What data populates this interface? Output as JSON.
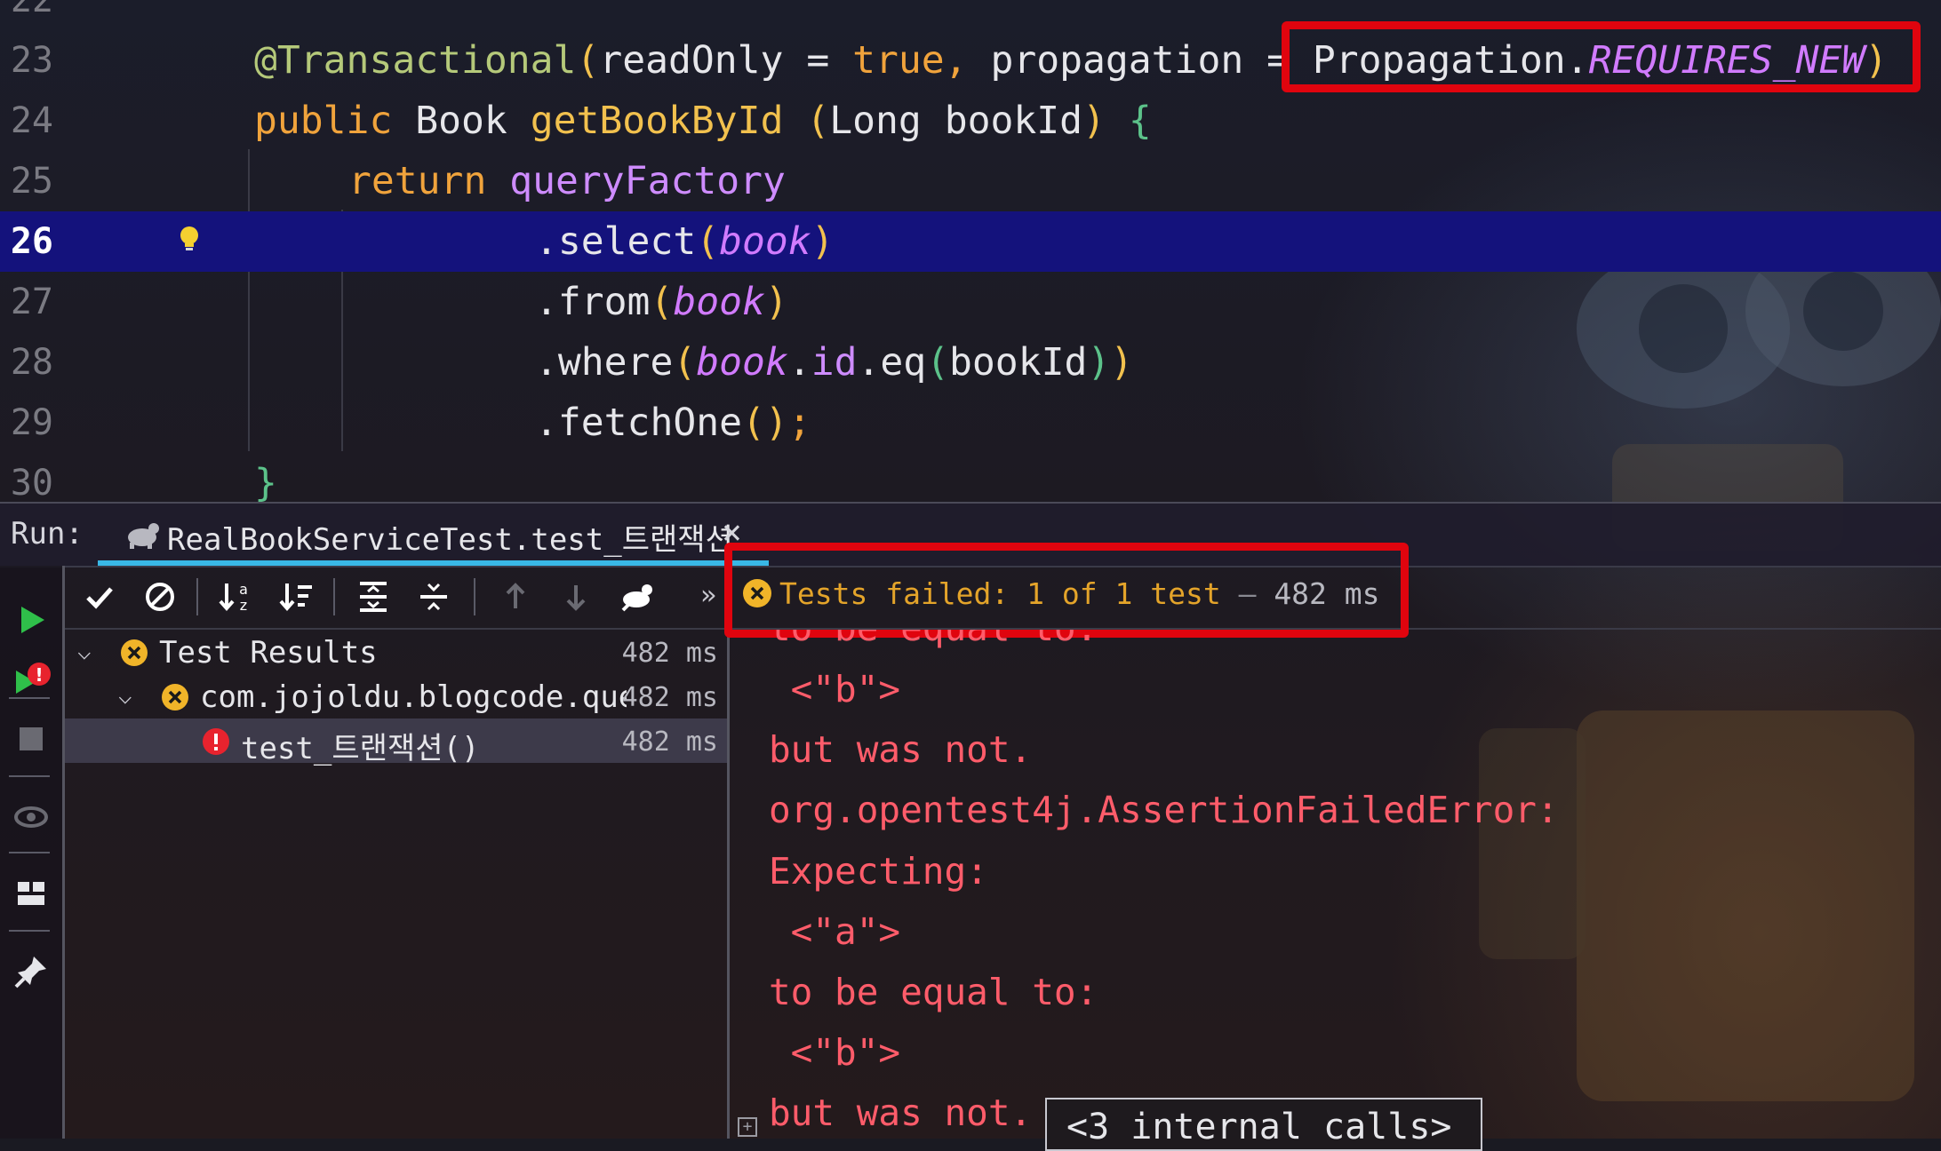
{
  "editor": {
    "current_line": "26",
    "lines": [
      {
        "num": "22"
      },
      {
        "num": "23",
        "annotation": "@Transactional",
        "p_open": "(",
        "arg1": "readOnly",
        "eq1": " = ",
        "val1": "true",
        "comma": ", ",
        "arg2": "propagation",
        "eq2": " = ",
        "prop_class": "Propagation",
        "dot": ".",
        "prop_value": "REQUIRES_NEW",
        "p_close": ")"
      },
      {
        "num": "24",
        "kw": "public",
        "type": "Book",
        "method": "getBookById",
        "p_open": "(",
        "param_type": "Long",
        "param": "bookId",
        "p_close": ")",
        "brace": "{"
      },
      {
        "num": "25",
        "kw": "return",
        "ident": "queryFactory"
      },
      {
        "num": "26",
        "method": ".select",
        "p_open": "(",
        "arg": "book",
        "p_close": ")"
      },
      {
        "num": "27",
        "method": ".from",
        "p_open": "(",
        "arg": "book",
        "p_close": ")"
      },
      {
        "num": "28",
        "method": ".where",
        "p_open": "(",
        "arg": "book",
        "dot": ".",
        "field": "id",
        "eq": ".eq",
        "p2_open": "(",
        "param": "bookId",
        "p2_close": ")",
        "p_close": ")"
      },
      {
        "num": "29",
        "method": ".fetchOne",
        "parens": "()",
        "semi": ";"
      },
      {
        "num": "30",
        "brace": "}"
      }
    ]
  },
  "run": {
    "label": "Run:",
    "tab_title": "RealBookServiceTest.test_트랜잭션",
    "close": "×"
  },
  "status": {
    "text": "Tests failed: 1 of 1 test",
    "separator": " – ",
    "time": "482 ms"
  },
  "tree": {
    "rows": [
      {
        "label": "Test Results",
        "time": "482 ms",
        "status": "failed"
      },
      {
        "label": "com.jojoldu.blogcode.querydsl",
        "time": "482 ms",
        "status": "failed"
      },
      {
        "label": "test_트랜잭션()",
        "time": "482 ms",
        "status": "error"
      }
    ]
  },
  "console": {
    "lines": [
      "to be equal to:",
      " <\"b\">",
      "but was not.",
      "org.opentest4j.AssertionFailedError:",
      "Expecting:",
      " <\"a\">",
      "to be equal to:",
      " <\"b\">",
      "but was not."
    ],
    "internal_calls": "<3 internal calls>",
    "fold": "+"
  },
  "colors": {
    "highlight_box": "#e0040e",
    "current_line_bg": "#14127c",
    "status_failed": "#e4a42a",
    "console_error": "#ff5c6a",
    "tab_underline": "#39b8e6"
  },
  "icons": {
    "toolbar": [
      "run-icon",
      "rerun-failed-icon",
      "stop-icon",
      "show-passed-icon",
      "show-ignored-icon",
      "sort-alpha-icon",
      "sort-duration-icon",
      "expand-all-icon",
      "collapse-all-icon",
      "prev-failed-icon",
      "next-failed-icon",
      "import-tests-icon",
      "more-icon"
    ]
  }
}
